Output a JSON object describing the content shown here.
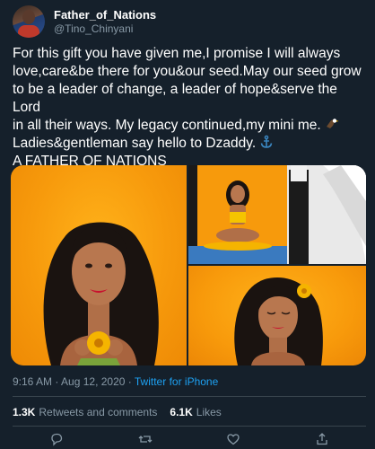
{
  "tweet": {
    "display_name": "Father_of_Nations",
    "handle": "@Tino_Chinyani",
    "text_lines": [
      "For this gift you have given me,I promise I will always",
      "love,care&be there for you&our seed.May our seed grow",
      "to be a leader of change, a leader of hope&serve the Lord",
      "in all their ways. My legacy continued,my mini me.",
      "Ladies&gentleman say hello to Dzaddy.",
      "A FATHER OF NATIONS"
    ],
    "time": "9:16 AM · Aug 12, 2020 ·",
    "source": "Twitter for iPhone",
    "stats": {
      "retweets_count": "1.3K",
      "retweets_label": "Retweets and comments",
      "likes_count": "6.1K",
      "likes_label": "Likes"
    }
  },
  "icons": {
    "line4_emoji": "eagle-icon",
    "line5_emoji": "anchor-icon",
    "actions": [
      "reply-icon",
      "retweet-icon",
      "like-icon",
      "share-icon"
    ]
  },
  "colors": {
    "background": "#15202b",
    "text": "#ffffff",
    "secondary": "#8899a6",
    "link": "#1da1f2",
    "photo_orange": "#f79a0c"
  }
}
